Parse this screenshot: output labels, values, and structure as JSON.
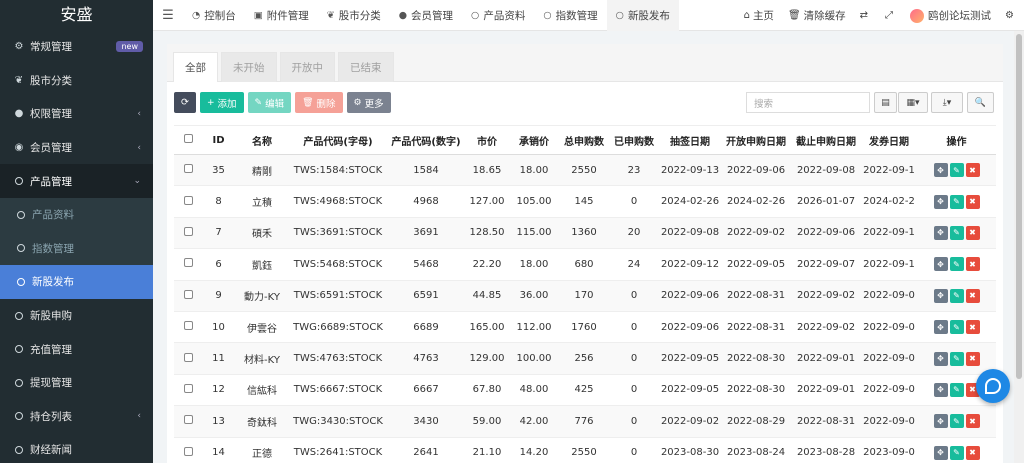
{
  "app": {
    "title": "安盛"
  },
  "sidebar": {
    "items": [
      {
        "label": "常规管理",
        "icon": "cogs-icon",
        "badge": "new"
      },
      {
        "label": "股市分类",
        "icon": "leaf-icon"
      },
      {
        "label": "权限管理",
        "icon": "users-icon",
        "caret": "‹"
      },
      {
        "label": "会员管理",
        "icon": "user-circle-icon",
        "caret": "‹"
      },
      {
        "label": "产品管理",
        "icon": "circle-icon",
        "caret": "⌄"
      }
    ],
    "submenu": [
      {
        "label": "产品资料"
      },
      {
        "label": "指数管理"
      },
      {
        "label": "新股发布"
      }
    ],
    "more_items": [
      {
        "label": "新股申购"
      },
      {
        "label": "充值管理"
      },
      {
        "label": "提现管理"
      },
      {
        "label": "持仓列表",
        "caret": "‹"
      },
      {
        "label": "财经新闻"
      }
    ]
  },
  "topbar": {
    "tabs": [
      {
        "label": "控制台",
        "icon": "dashboard-icon",
        "glyph": "◔"
      },
      {
        "label": "附件管理",
        "icon": "image-icon",
        "glyph": "▣"
      },
      {
        "label": "股市分类",
        "icon": "leaf-icon",
        "glyph": "❦"
      },
      {
        "label": "会员管理",
        "icon": "user-icon",
        "glyph": "●"
      },
      {
        "label": "产品资料",
        "icon": "circle-icon",
        "glyph": "○"
      },
      {
        "label": "指数管理",
        "icon": "circle-icon",
        "glyph": "○"
      },
      {
        "label": "新股发布",
        "icon": "circle-icon",
        "glyph": "○"
      }
    ],
    "right": {
      "home": "主页",
      "clear_cache": "清除缓存",
      "user": "鸥创论坛测试"
    }
  },
  "subtabs": [
    "全部",
    "未开始",
    "开放中",
    "已结束"
  ],
  "toolbar": {
    "add": "添加",
    "edit": "编辑",
    "delete": "删除",
    "more": "更多",
    "search_placeholder": "搜索"
  },
  "table": {
    "headers": [
      "ID",
      "名称",
      "产品代码(字母)",
      "产品代码(数字)",
      "市价",
      "承销价",
      "总申购数",
      "已申购数",
      "抽签日期",
      "开放申购日期",
      "截止申购日期",
      "发券日期",
      "操作"
    ],
    "rows": [
      [
        "35",
        "精剛",
        "TWS:1584:STOCK",
        "1584",
        "18.65",
        "18.00",
        "2550",
        "23",
        "2022-09-13",
        "2022-09-06",
        "2022-09-08",
        "2022-09-1"
      ],
      [
        "8",
        "立積",
        "TWS:4968:STOCK",
        "4968",
        "127.00",
        "105.00",
        "145",
        "0",
        "2024-02-26",
        "2024-02-26",
        "2026-01-07",
        "2024-02-2"
      ],
      [
        "7",
        "碩禾",
        "TWS:3691:STOCK",
        "3691",
        "128.50",
        "115.00",
        "1360",
        "20",
        "2022-09-08",
        "2022-09-02",
        "2022-09-06",
        "2022-09-1"
      ],
      [
        "6",
        "凱鈺",
        "TWS:5468:STOCK",
        "5468",
        "22.20",
        "18.00",
        "680",
        "24",
        "2022-09-12",
        "2022-09-05",
        "2022-09-07",
        "2022-09-1"
      ],
      [
        "9",
        "動力-KY",
        "TWS:6591:STOCK",
        "6591",
        "44.85",
        "36.00",
        "170",
        "0",
        "2022-09-06",
        "2022-08-31",
        "2022-09-02",
        "2022-09-0"
      ],
      [
        "10",
        "伊雲谷",
        "TWG:6689:STOCK",
        "6689",
        "165.00",
        "112.00",
        "1760",
        "0",
        "2022-09-06",
        "2022-08-31",
        "2022-09-02",
        "2022-09-0"
      ],
      [
        "11",
        "材料-KY",
        "TWS:4763:STOCK",
        "4763",
        "129.00",
        "100.00",
        "256",
        "0",
        "2022-09-05",
        "2022-08-30",
        "2022-09-01",
        "2022-09-0"
      ],
      [
        "12",
        "信紘科",
        "TWS:6667:STOCK",
        "6667",
        "67.80",
        "48.00",
        "425",
        "0",
        "2022-09-05",
        "2022-08-30",
        "2022-09-01",
        "2022-09-0"
      ],
      [
        "13",
        "奇鈦科",
        "TWG:3430:STOCK",
        "3430",
        "59.00",
        "42.00",
        "776",
        "0",
        "2022-09-02",
        "2022-08-29",
        "2022-08-31",
        "2022-09-0"
      ],
      [
        "14",
        "正德",
        "TWS:2641:STOCK",
        "2641",
        "21.10",
        "14.20",
        "2550",
        "0",
        "2023-08-30",
        "2023-08-24",
        "2023-08-28",
        "2023-09-0"
      ]
    ]
  }
}
